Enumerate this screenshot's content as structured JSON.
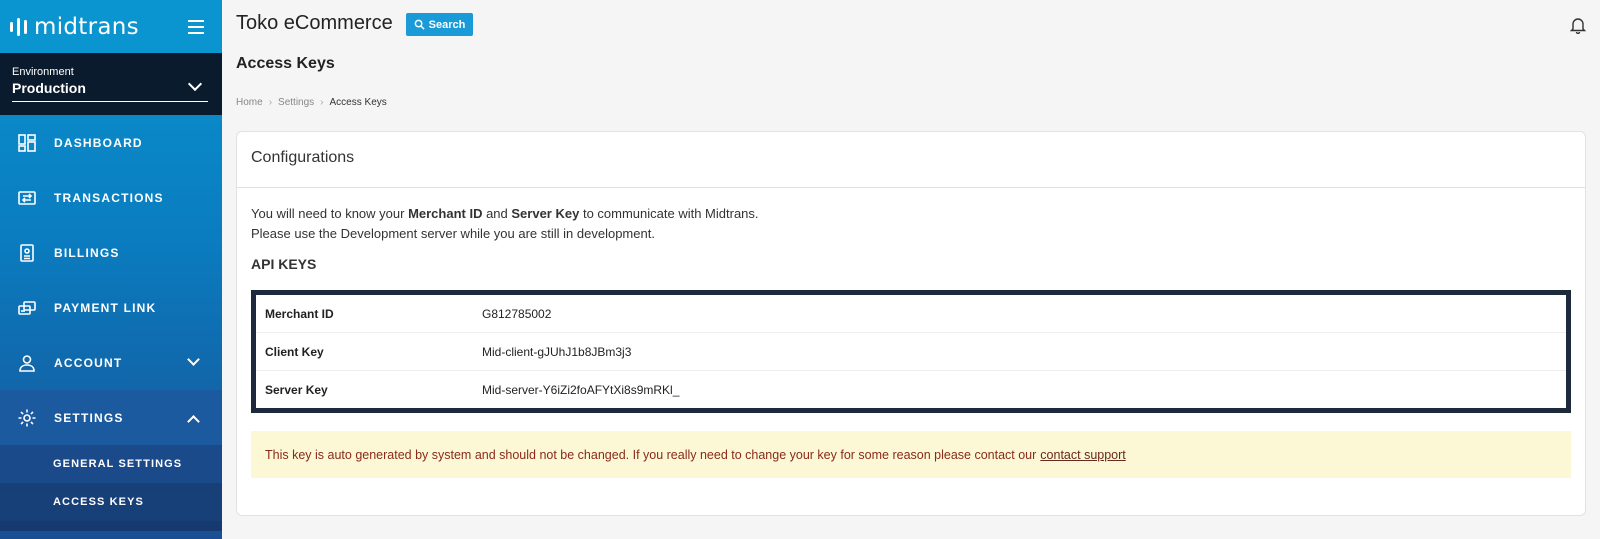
{
  "brand": {
    "name": "midtrans"
  },
  "environment": {
    "label": "Environment",
    "value": "Production"
  },
  "sidebar": {
    "items": [
      {
        "label": "DASHBOARD",
        "icon": "dashboard-icon"
      },
      {
        "label": "TRANSACTIONS",
        "icon": "transactions-icon"
      },
      {
        "label": "BILLINGS",
        "icon": "billings-icon"
      },
      {
        "label": "PAYMENT LINK",
        "icon": "payment-link-icon"
      },
      {
        "label": "ACCOUNT",
        "icon": "user-icon"
      },
      {
        "label": "SETTINGS",
        "icon": "gear-icon"
      }
    ],
    "settings_sub": [
      {
        "label": "GENERAL SETTINGS"
      },
      {
        "label": "ACCESS KEYS"
      }
    ]
  },
  "header": {
    "store_name": "Toko eCommerce",
    "search_label": "Search"
  },
  "page": {
    "title": "Access Keys"
  },
  "breadcrumb": [
    "Home",
    "Settings",
    "Access Keys"
  ],
  "card": {
    "title": "Configurations",
    "intro": {
      "line1_a": "You will need to know your ",
      "merchant_id": "Merchant ID",
      "and": " and ",
      "server_key": "Server Key",
      "line1_b": " to communicate with Midtrans.",
      "line2": "Please use the Development server while you are still in development."
    },
    "api_keys_title": "API KEYS",
    "keys": [
      {
        "name": "Merchant ID",
        "value": "G812785002"
      },
      {
        "name": "Client Key",
        "value": "Mid-client-gJUhJ1b8JBm3j3"
      },
      {
        "name": "Server Key",
        "value": "Mid-server-Y6iZi2foAFYtXi8s9mRKl_"
      }
    ],
    "notice": {
      "text": "This key is auto generated by system and should not be changed. If you really need to change your key for some reason please contact our",
      "link": "contact support"
    }
  },
  "colors": {
    "sidebar_top": "#0a93cf",
    "sidebar_bottom": "#1a4f93",
    "environment_bg": "#0b1b2e",
    "search_button": "#1a9bd7",
    "keys_border": "#1d2a3c",
    "notice_bg": "#fcf8d6",
    "notice_text": "#8a2a1a"
  }
}
